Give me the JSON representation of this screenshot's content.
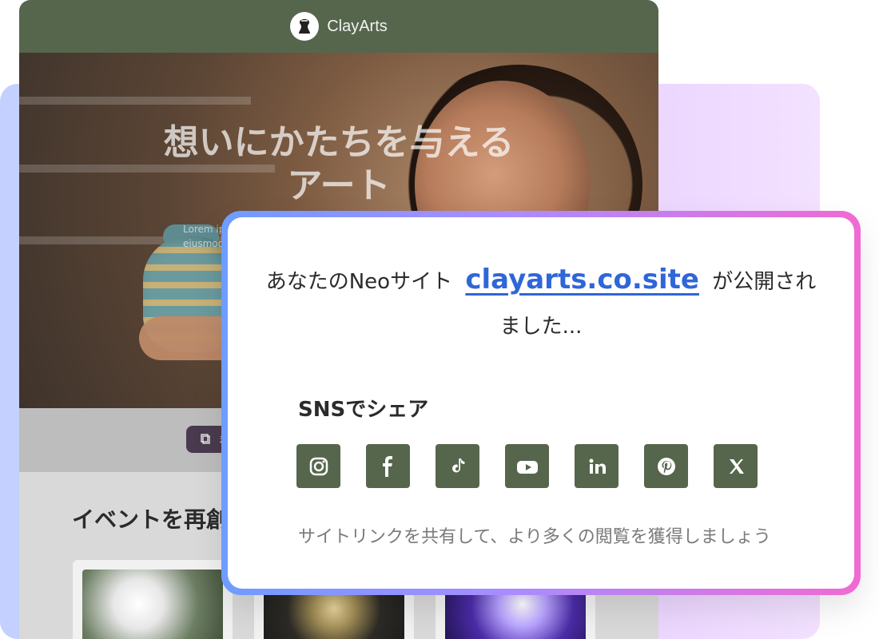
{
  "site": {
    "brand": "ClayArts",
    "hero": {
      "title_line1": "想いにかたちを与える",
      "title_line2": "アート",
      "subtitle_line1": "Lorem ip",
      "subtitle_line2": "eiusmod"
    },
    "pill_label": "私",
    "section_title": "イベントを再創"
  },
  "dialog": {
    "prefix": "あなたのNeoサイト",
    "domain": "clayarts.co.site",
    "suffix": "が公開され",
    "line2": "ました...",
    "share_title": "SNSでシェア",
    "hint": "サイトリンクを共有して、より多くの閲覧を獲得しましょう",
    "social": [
      {
        "name": "instagram-icon"
      },
      {
        "name": "facebook-icon"
      },
      {
        "name": "tiktok-icon"
      },
      {
        "name": "youtube-icon"
      },
      {
        "name": "linkedin-icon"
      },
      {
        "name": "pinterest-icon"
      },
      {
        "name": "x-icon"
      }
    ]
  },
  "colors": {
    "site_header": "#56664d",
    "social_button": "#56664d",
    "link": "#2f66d8",
    "gradient_start": "#6e9cff",
    "gradient_end": "#f06ad3"
  }
}
